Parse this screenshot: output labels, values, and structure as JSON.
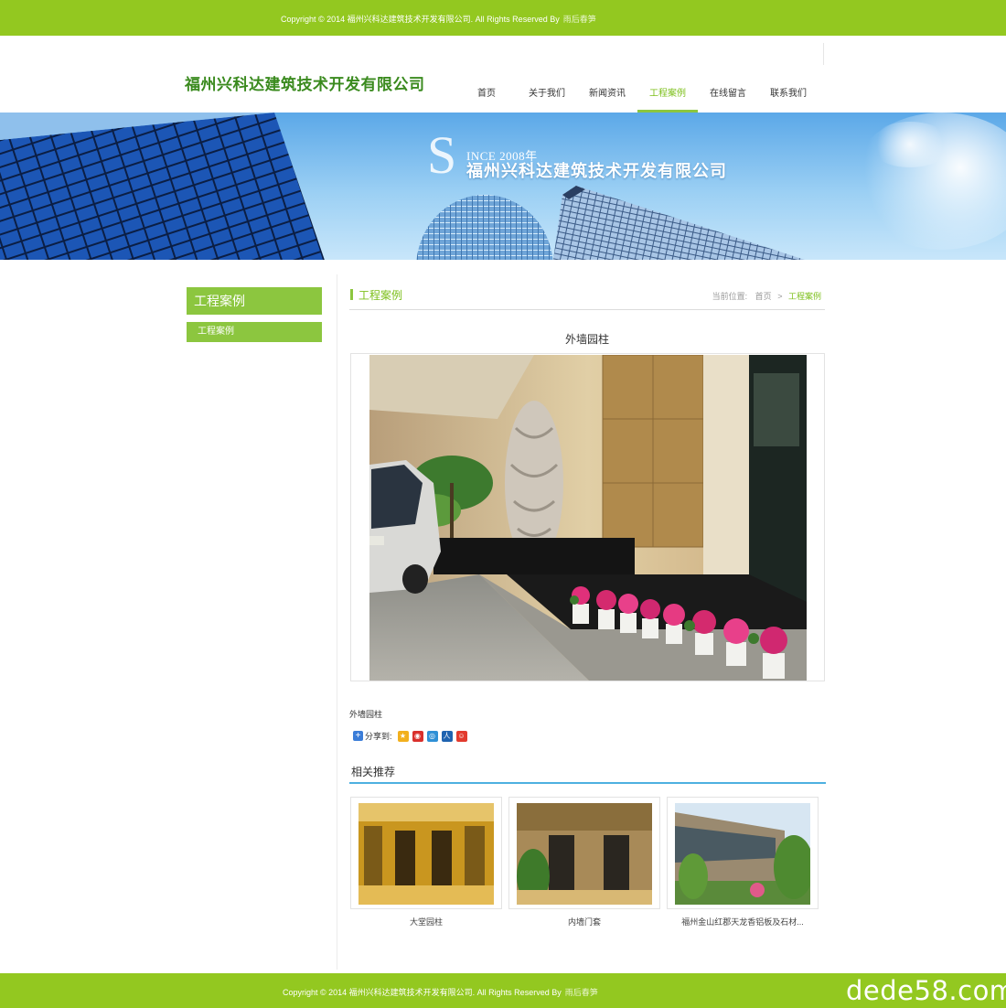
{
  "top_bar": {
    "copyright": "Copyright © 2014 福州兴科达建筑技术开发有限公司. All Rights Reserved By",
    "author_link": "雨后春笋"
  },
  "header": {
    "logo_text": "福州兴科达建筑技术开发有限公司",
    "nav": [
      {
        "label": "首页"
      },
      {
        "label": "关于我们"
      },
      {
        "label": "新闻资讯"
      },
      {
        "label": "工程案例",
        "active": true
      },
      {
        "label": "在线留言"
      },
      {
        "label": "联系我们"
      }
    ]
  },
  "banner": {
    "since_letter": "S",
    "since_text": "INCE 2008年",
    "company_name": "福州兴科达建筑技术开发有限公司"
  },
  "sidebar": {
    "title": "工程案例",
    "items": [
      {
        "label": "工程案例"
      }
    ]
  },
  "content": {
    "section_title": "工程案例",
    "breadcrumb": {
      "prefix": "当前位置:",
      "home": "首页",
      "separator": ">",
      "current": "工程案例"
    },
    "article_title": "外墙园柱",
    "caption": "外墙园柱",
    "share": {
      "label": "分享到:",
      "icons": [
        "qzone-icon",
        "sina-weibo-icon",
        "tencent-weibo-icon",
        "renren-icon",
        "kaixin-icon"
      ]
    },
    "related": {
      "heading": "相关推荐",
      "items": [
        {
          "name": "大堂园柱"
        },
        {
          "name": "内墙门套"
        },
        {
          "name": "福州金山红郡天龙香铝板及石材..."
        }
      ]
    }
  },
  "footer": {
    "copyright": "Copyright © 2014 福州兴科达建筑技术开发有限公司. All Rights Reserved By",
    "author_link": "雨后春笋",
    "watermark": "dede58.com"
  },
  "colors": {
    "brand_green": "#93c820",
    "accent_green": "#8cc63f",
    "related_underline": "#4db0e0"
  }
}
